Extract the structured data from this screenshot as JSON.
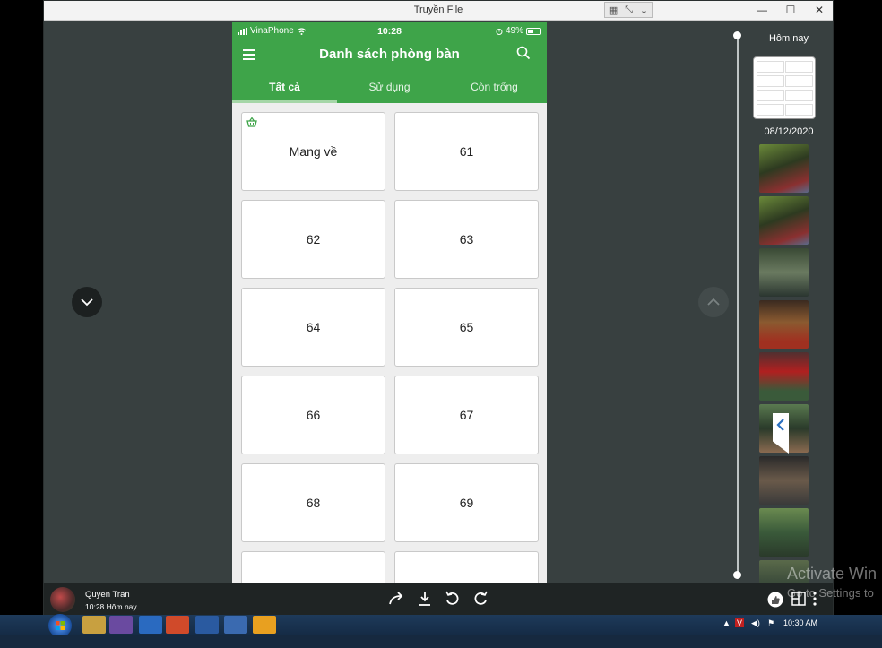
{
  "window": {
    "title": "Truyền File",
    "minimize": "—",
    "maximize": "☐",
    "close": "✕"
  },
  "phone": {
    "carrier": "VinaPhone",
    "time": "10:28",
    "battery": "49%",
    "battery_level": 0.49,
    "app_title": "Danh sách phòng bàn",
    "tabs": [
      {
        "label": "Tất cả",
        "active": true
      },
      {
        "label": "Sử dụng",
        "active": false
      },
      {
        "label": "Còn trống",
        "active": false
      }
    ],
    "tables": [
      "Mang về",
      "61",
      "62",
      "63",
      "64",
      "65",
      "66",
      "67",
      "68",
      "69",
      "",
      ""
    ],
    "accent": "#3ea449"
  },
  "sidebar": {
    "today_label": "Hôm nay",
    "date_label": "08/12/2020"
  },
  "footer": {
    "user_name": "Quyen Tran",
    "user_time": "10:28 Hôm nay"
  },
  "watermark": {
    "line1": "Activate Win",
    "line2": "Go to Settings to"
  },
  "taskbar": {
    "clock": "10:30 AM"
  }
}
